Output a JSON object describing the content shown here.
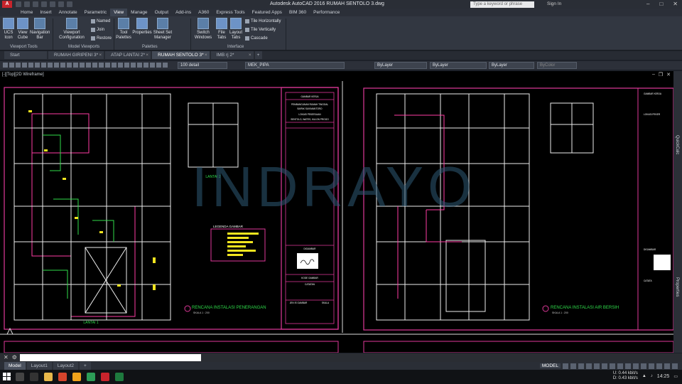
{
  "app": {
    "brand": "A",
    "title": "Autodesk AutoCAD 2016    RUMAH SENTOLO 3.dwg",
    "search_placeholder": "Type a keyword or phrase",
    "sign_in": "Sign In"
  },
  "menu": [
    "Home",
    "Insert",
    "Annotate",
    "Parametric",
    "View",
    "Manage",
    "Output",
    "Add-ins",
    "A360",
    "Express Tools",
    "Featured Apps",
    "BIM 360",
    "Performance"
  ],
  "active_menu": "View",
  "ribbon": {
    "buttons": [
      "UCS Icon",
      "View Cube",
      "Navigation Bar",
      "Viewport Configuration",
      "Tool Palettes",
      "Properties",
      "Sheet Set Manager",
      "Switch Windows",
      "File Tabs",
      "Layout Tabs"
    ],
    "small": [
      "Named",
      "Join",
      "Restore",
      "Tile Horizontally",
      "Tile Vertically",
      "Cascade"
    ],
    "groups": [
      "Viewport Tools",
      "Model Viewports",
      "Palettes",
      "Interface"
    ]
  },
  "file_tabs": [
    "Start",
    "RUMAH GIRIPENI 3*",
    "ATAP LANTAI 2*",
    "RUMAH SENTOLO 3*",
    "IMB rj 2*"
  ],
  "active_file_tab": "RUMAH SENTOLO 3*",
  "toolbar": {
    "dim_style": "100 detail",
    "layer": "MEK_PIPA",
    "color": "ByLayer",
    "linetype": "ByLayer",
    "lineweight": "ByLayer",
    "plotstyle": "ByColor"
  },
  "viewport": {
    "label": "[-][Top][2D Wireframe]",
    "watermark": "INDRAYO",
    "left_sheet": {
      "plan_label": "LANTAI 1",
      "detail_label": "LANTAI 2",
      "legend_title": "LEGENDA GAMBAR",
      "drawing_title": "RENCANA INSTALASI PENERANGAN",
      "scale": "SKALA 1 : 200",
      "title_block": [
        "GAMBAR KERJA",
        "PEMBANGUNAN RUMAH TINGGAL",
        "BAPAK SUKIMANTORO",
        "LOKASI PEKERJAAN",
        "SENTOLO, WATES, KULON PROGO",
        "DIGAMBAR",
        "KODE GAMBAR",
        "CATATAN",
        "JEN IS GAMBAR",
        "SKALA"
      ]
    },
    "right_sheet": {
      "drawing_title": "RENCANA INSTALASI AIR BERSIH",
      "scale": "SKALA 1 : 200",
      "title_block": [
        "GAMBAR KERJA",
        "LOKASI PEKER",
        "DIGAMBAR",
        "CATATA"
      ]
    }
  },
  "right_palettes": [
    "QuickCalc",
    "Properties"
  ],
  "command_input": "",
  "layout_tabs": [
    "Model",
    "Layout1",
    "Layout2"
  ],
  "active_layout": "Model",
  "status_model": "MODEL",
  "tray": {
    "up": "U: 0.44 kbit/s",
    "down": "D: 0.43 kbit/s",
    "time": "14:25"
  },
  "colors": {
    "accent": "#3b6db0",
    "sheet": "#e0389a",
    "walls": "#e0e0e0",
    "green": "#2fdc4a",
    "yellow": "#f2e51f"
  }
}
